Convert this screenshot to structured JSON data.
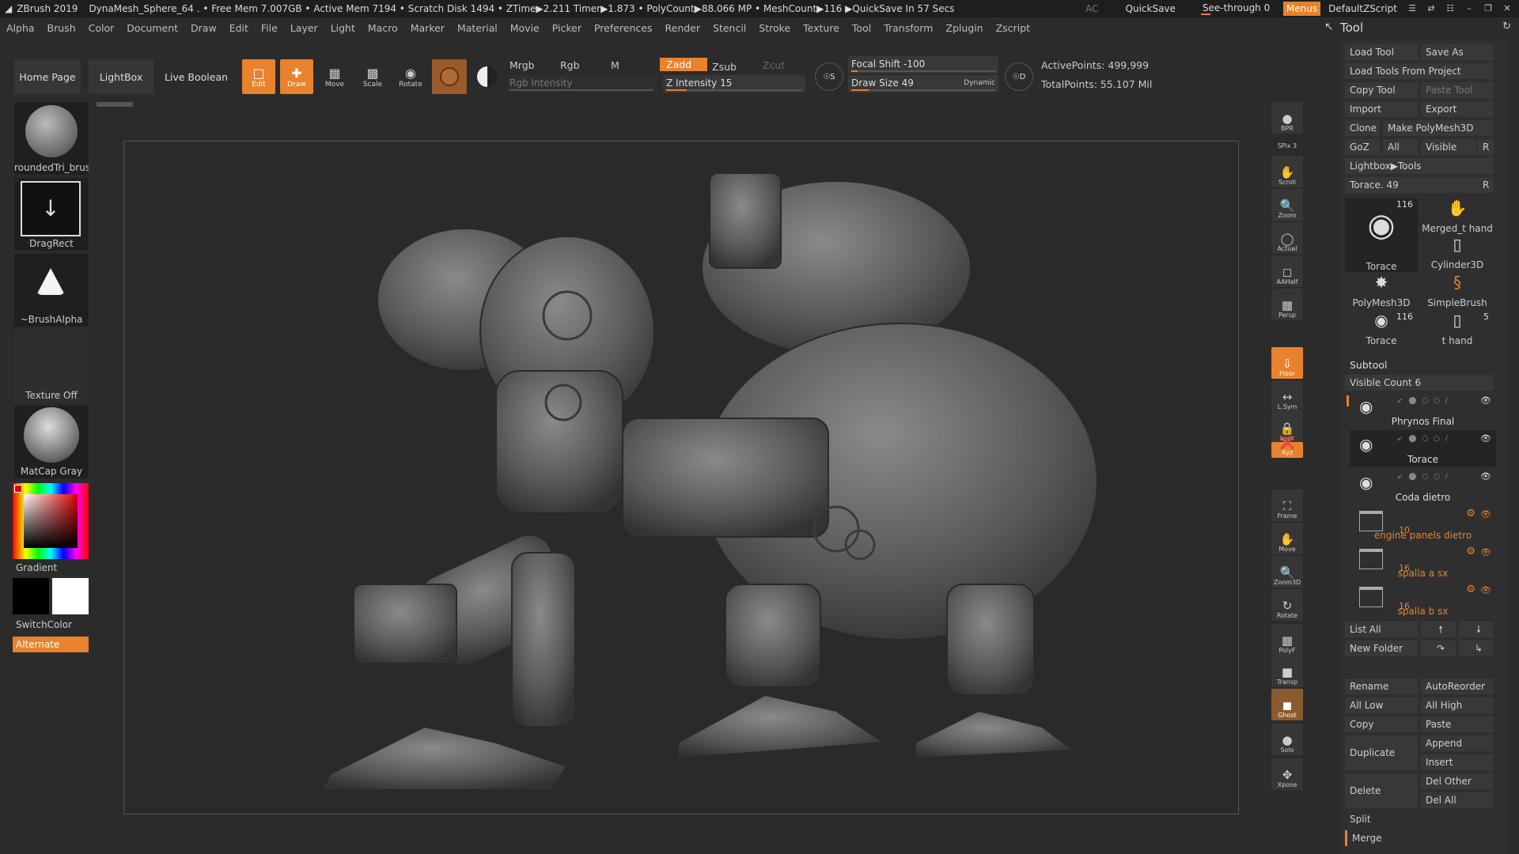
{
  "titlebar": {
    "title": "ZBrush 2019",
    "info": "DynaMesh_Sphere_64  .  • Free Mem 7.007GB • Active Mem 7194 • Scratch Disk 1494 •  ZTime▶2.211 Timer▶1.873 • PolyCount▶88.066 MP  • MeshCount▶116  ▶QuickSave In 57 Secs",
    "ac": "AC",
    "quicksave": "QuickSave",
    "see_through": "See-through  0",
    "menus": "Menus",
    "script": "DefaultZScript"
  },
  "menubar": [
    "Alpha",
    "Brush",
    "Color",
    "Document",
    "Draw",
    "Edit",
    "File",
    "Layer",
    "Light",
    "Macro",
    "Marker",
    "Material",
    "Movie",
    "Picker",
    "Preferences",
    "Render",
    "Stencil",
    "Stroke",
    "Texture",
    "Tool",
    "Transform",
    "Zplugin",
    "Zscript"
  ],
  "toolbar": {
    "home": "Home Page",
    "lightbox": "LightBox",
    "live_boolean": "Live Boolean",
    "edit": "Edit",
    "draw": "Draw",
    "move": "Move",
    "scale": "Scale",
    "rotate": "Rotate",
    "mrgb": "Mrgb",
    "rgb": "Rgb",
    "m": "M",
    "rgb_intensity": "Rgb Intensity",
    "zadd": "Zadd",
    "zsub": "Zsub",
    "zcut": "Zcut",
    "z_intensity": "Z Intensity 15",
    "focal_shift": "Focal Shift -100",
    "draw_size": "Draw Size 49",
    "dynamic": "Dynamic",
    "active_points": "ActivePoints: 499,999",
    "total_points": "TotalPoints: 55.107 Mil",
    "z_intensity_pct": 0.15,
    "draw_size_pct": 0.12
  },
  "leftshelf": {
    "brush": "roundedTri_brus",
    "stroke": "DragRect",
    "alpha": "~BrushAlpha",
    "texture": "Texture Off",
    "material": "MatCap Gray",
    "gradient": "Gradient",
    "switchcolor": "SwitchColor",
    "alternate": "Alternate"
  },
  "rightshelf": [
    "BPR",
    "SPix 3",
    "Scroll",
    "Zoom",
    "Actual",
    "AAHalf",
    "Persp",
    "Floor",
    "L.Sym",
    "Lock",
    "Xyz",
    "Frame",
    "Move",
    "Zoom3D",
    "Rotate",
    "PolyF",
    "Transp",
    "Ghost",
    "Solo",
    "Xpose"
  ],
  "toolpanel": {
    "title": "Tool",
    "load_tool": "Load Tool",
    "save_as": "Save As",
    "load_from_project": "Load Tools From Project",
    "copy_tool": "Copy Tool",
    "paste_tool": "Paste Tool",
    "import": "Import",
    "export": "Export",
    "clone": "Clone",
    "make_polymesh": "Make PolyMesh3D",
    "goz": "GoZ",
    "all": "All",
    "visible": "Visible",
    "r": "R",
    "lightbox_tools": "Lightbox▶Tools",
    "torace_slider": "Torace. 49",
    "thumbs": [
      {
        "name": "Torace",
        "num": "116"
      },
      {
        "name": "Merged_t hand",
        "num": ""
      },
      {
        "name": "Cylinder3D",
        "num": ""
      },
      {
        "name": "PolyMesh3D",
        "num": ""
      },
      {
        "name": "SimpleBrush",
        "num": ""
      },
      {
        "name": "Torace",
        "num": "116"
      },
      {
        "name": "t hand",
        "num": "5"
      }
    ],
    "subtool_title": "Subtool",
    "visible_count": "Visible Count 6",
    "subtools": [
      {
        "name": "Phrynos Final",
        "num": ""
      },
      {
        "name": "Torace",
        "num": ""
      },
      {
        "name": "Coda dietro",
        "num": ""
      },
      {
        "name": "engine panels dietro",
        "num": "10"
      },
      {
        "name": "spalla a sx",
        "num": "16"
      },
      {
        "name": "spalla b sx",
        "num": "16"
      }
    ],
    "list_all": "List All",
    "new_folder": "New Folder",
    "rename": "Rename",
    "autoreorder": "AutoReorder",
    "all_low": "All Low",
    "all_high": "All High",
    "copy": "Copy",
    "paste": "Paste",
    "duplicate": "Duplicate",
    "append": "Append",
    "insert": "Insert",
    "delete": "Delete",
    "del_other": "Del Other",
    "del_all": "Del All",
    "split": "Split",
    "merge": "Merge"
  },
  "colors": {
    "accent": "#e8822c",
    "bg": "#2b2b2b",
    "panel": "#383838"
  }
}
